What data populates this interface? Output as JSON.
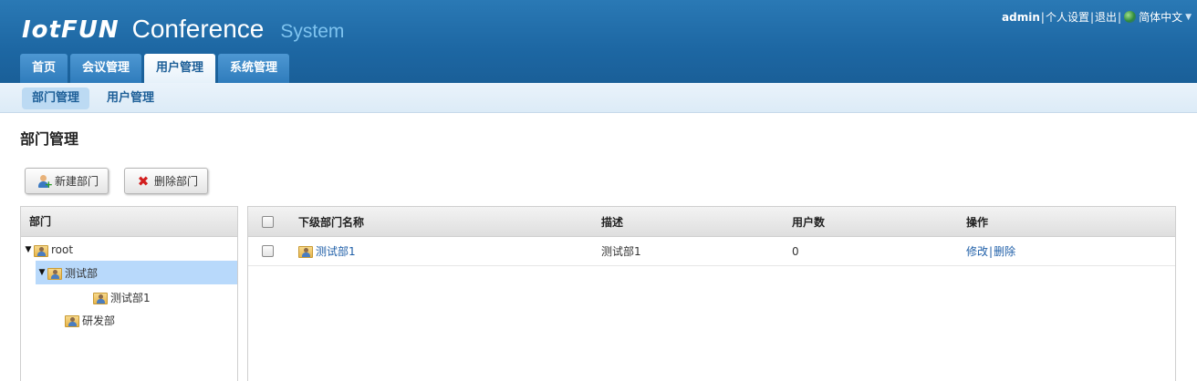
{
  "header": {
    "logo_mark": "IotFUN",
    "logo_main": "Conference",
    "logo_sub": "System",
    "user": "admin",
    "sep": "|",
    "personal_settings": "个人设置",
    "logout": "退出",
    "language": "简体中文",
    "colors": {
      "header_bg": "#1d67a3",
      "accent_light": "#7ec3ef"
    }
  },
  "main_tabs": [
    {
      "label": "首页"
    },
    {
      "label": "会议管理"
    },
    {
      "label": "用户管理",
      "active": true
    },
    {
      "label": "系统管理"
    }
  ],
  "sub_tabs": [
    {
      "label": "部门管理",
      "active": true
    },
    {
      "label": "用户管理"
    }
  ],
  "page_title": "部门管理",
  "toolbar": {
    "new_dept": "新建部门",
    "delete_dept": "删除部门"
  },
  "tree": {
    "header": "部门",
    "nodes": [
      {
        "label": "root",
        "expanded": true
      },
      {
        "label": "测试部",
        "expanded": true,
        "selected": true
      },
      {
        "label": "测试部1"
      },
      {
        "label": "研发部"
      }
    ]
  },
  "grid": {
    "columns": [
      "下级部门名称",
      "描述",
      "用户数",
      "操作"
    ],
    "rows": [
      {
        "name": "测试部1",
        "desc": "测试部1",
        "users": "0",
        "edit": "修改",
        "delete": "删除"
      }
    ]
  }
}
